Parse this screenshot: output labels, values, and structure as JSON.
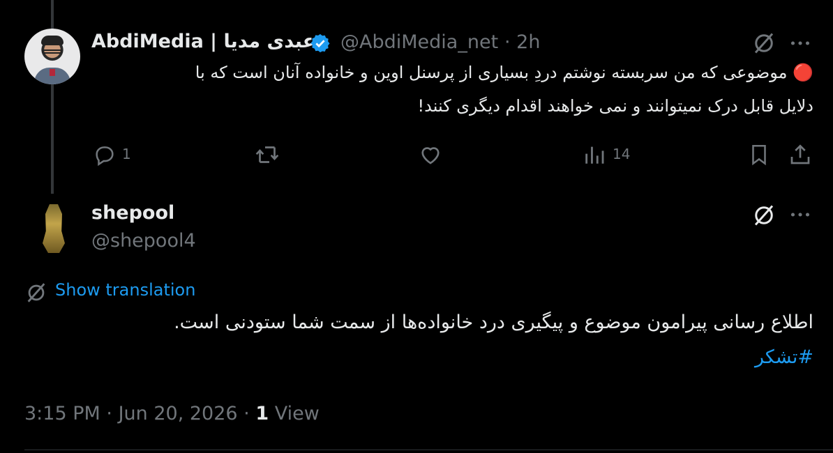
{
  "tweet1": {
    "display_name": "AbdiMedia | عبدی مدیا",
    "handle": "@AbdiMedia_net",
    "time": "· 2h",
    "text_line1": "🔴 موضوعی که من سربسته نوشتم دردِ بسیاری از پرسنل اوین و خانواده آنان است که با",
    "text_line2": "دلایل قابل درک نمیتوانند و نمی خواهند اقدام دیگری کنند!",
    "reply_count": "1",
    "views_count": "14"
  },
  "tweet2": {
    "display_name": "shepool",
    "handle": "@shepool4",
    "show_translation": "Show translation",
    "text_line1": "اطلاع رسانی پیرامون موضوع و پیگیری درد خانواده‌ها از سمت شما ستودنی است.",
    "hashtag": "#تشکر",
    "time": "3:15 PM",
    "date": "Jun 20, 2026",
    "view_count": "1",
    "view_label": "View"
  },
  "colors": {
    "accent": "#1d9bf0",
    "muted": "#71767b",
    "text": "#e7e9ea"
  },
  "icons": [
    "verified-badge-icon",
    "grok-icon",
    "more-icon",
    "reply-icon",
    "retweet-icon",
    "like-icon",
    "views-icon",
    "bookmark-icon",
    "share-icon",
    "translate-icon"
  ]
}
